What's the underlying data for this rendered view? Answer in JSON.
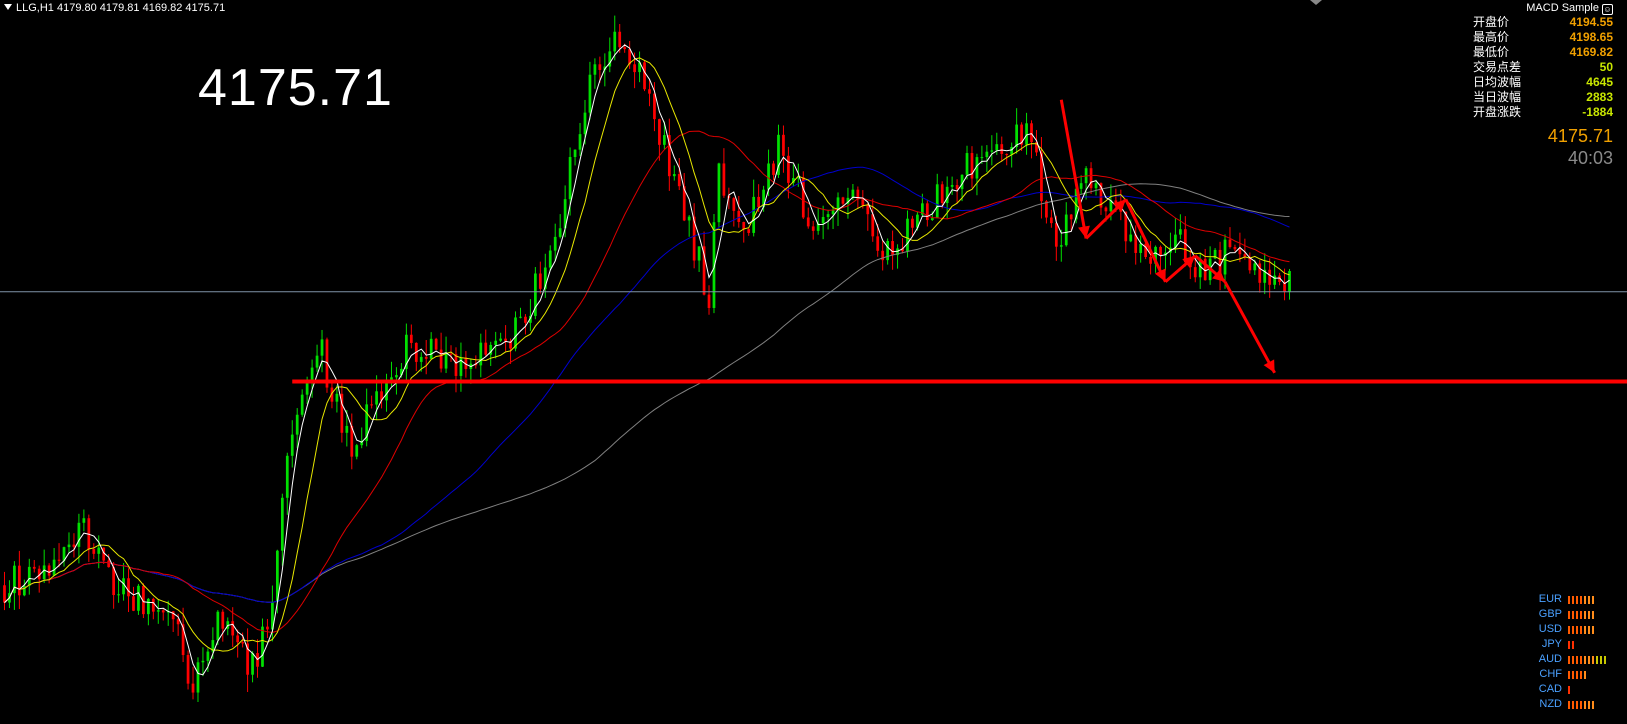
{
  "symbol_line": "LLG,H1  4179.80 4179.81 4169.82 4175.71",
  "big_price": "4175.71",
  "ea_name": "MACD Sample",
  "stats": [
    {
      "label": "开盘价",
      "value": "4194.55",
      "color": "#f0a000"
    },
    {
      "label": "最高价",
      "value": "4198.65",
      "color": "#f0a000"
    },
    {
      "label": "最低价",
      "value": "4169.82",
      "color": "#f0a000"
    },
    {
      "label": "交易点差",
      "value": "50",
      "color": "#c8e600"
    },
    {
      "label": "日均波幅",
      "value": "4645",
      "color": "#c8e600"
    },
    {
      "label": "当日波幅",
      "value": "2883",
      "color": "#c8e600"
    },
    {
      "label": "开盘涨跌",
      "value": "-1884",
      "color": "#c8e600"
    }
  ],
  "current_price": "4175.71",
  "countdown": "40:03",
  "currency_strength": [
    {
      "currency": "EUR",
      "level": 7
    },
    {
      "currency": "GBP",
      "level": 7
    },
    {
      "currency": "USD",
      "level": 7
    },
    {
      "currency": "JPY",
      "level": 2
    },
    {
      "currency": "AUD",
      "level": 10
    },
    {
      "currency": "CHF",
      "level": 5
    },
    {
      "currency": "CAD",
      "level": 1
    },
    {
      "currency": "NZD",
      "level": 7
    }
  ],
  "colors": {
    "background": "#000000",
    "bull_candle": "#00e000",
    "bear_candle": "#ff0000",
    "ma_fast": "#ffffff",
    "ma_mid": "#e8e800",
    "ma_slow": "#dd0000",
    "ma_long": "#0000cc",
    "ma_longest": "#808080",
    "support_line": "#ff0000",
    "price_line": "#7f93a8",
    "arrow": "#ff0000"
  },
  "chart_data": {
    "type": "candlestick",
    "symbol": "LLG",
    "timeframe": "H1",
    "ylim": [
      4076,
      4243
    ],
    "bid_line": 4175.71,
    "support_level": 4155,
    "n_bars": 260,
    "price_path": [
      [
        0,
        4108
      ],
      [
        10,
        4113
      ],
      [
        16,
        4122
      ],
      [
        22,
        4108
      ],
      [
        28,
        4104
      ],
      [
        34,
        4099
      ],
      [
        38,
        4086
      ],
      [
        44,
        4101
      ],
      [
        50,
        4089
      ],
      [
        54,
        4104
      ],
      [
        58,
        4145
      ],
      [
        64,
        4161
      ],
      [
        70,
        4140
      ],
      [
        76,
        4152
      ],
      [
        82,
        4164
      ],
      [
        90,
        4158
      ],
      [
        96,
        4160
      ],
      [
        104,
        4168
      ],
      [
        110,
        4185
      ],
      [
        118,
        4222
      ],
      [
        124,
        4236
      ],
      [
        130,
        4220
      ],
      [
        136,
        4198
      ],
      [
        142,
        4175
      ],
      [
        144,
        4202
      ],
      [
        150,
        4192
      ],
      [
        156,
        4208
      ],
      [
        164,
        4189
      ],
      [
        170,
        4197
      ],
      [
        178,
        4185
      ],
      [
        184,
        4191
      ],
      [
        192,
        4203
      ],
      [
        200,
        4207
      ],
      [
        206,
        4214
      ],
      [
        212,
        4186
      ],
      [
        218,
        4201
      ],
      [
        224,
        4192
      ],
      [
        230,
        4183
      ],
      [
        236,
        4188
      ],
      [
        242,
        4180
      ],
      [
        248,
        4186
      ],
      [
        254,
        4177
      ]
    ],
    "moving_averages": {
      "ma_fast": {
        "color": "#ffffff"
      },
      "ma_mid": {
        "color": "#e8e800"
      },
      "ma_slow": {
        "color": "#dd0000"
      },
      "ma_long": {
        "color": "#0000cc"
      },
      "ma_longest": {
        "color": "#808080"
      }
    },
    "annotations": [
      {
        "type": "horizontal_line",
        "y": 4155,
        "x_from": 58,
        "color": "#ff0000"
      },
      {
        "type": "zigzag_arrows",
        "points": [
          [
            213,
            4220
          ],
          [
            218,
            4188
          ],
          [
            226,
            4197
          ],
          [
            234,
            4178
          ],
          [
            240,
            4184
          ],
          [
            246,
            4178
          ],
          [
            256,
            4157
          ]
        ],
        "color": "#ff0000"
      }
    ]
  }
}
